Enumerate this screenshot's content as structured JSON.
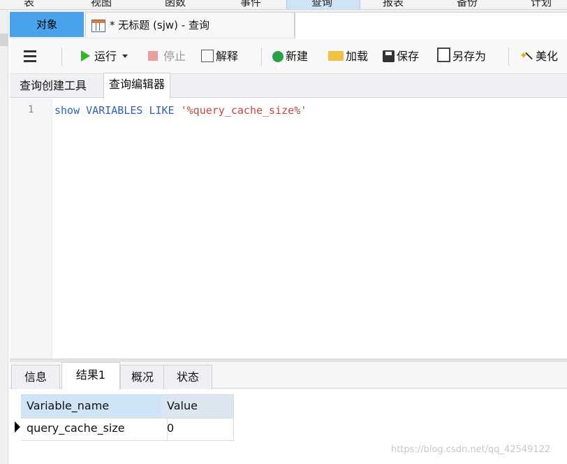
{
  "menu": {
    "items": [
      "表",
      "视图",
      "函数",
      "事件",
      "查询",
      "报表",
      "备份",
      "计划"
    ],
    "selected_index": 4
  },
  "tabs": {
    "objects_label": "对象",
    "query_tab_title": "* 无标题 (sjw) - 查询"
  },
  "toolbar": {
    "run_label": "运行",
    "stop_label": "停止",
    "explain_label": "解释",
    "new_label": "新建",
    "load_label": "加载",
    "save_label": "保存",
    "save_as_label": "另存为",
    "beautify_label": "美化"
  },
  "subtabs": {
    "builder_label": "查询创建工具",
    "editor_label": "查询编辑器"
  },
  "editor": {
    "line_number": "1",
    "code_keyword": "show VARIABLES LIKE",
    "code_string": "'%query_cache_size%'"
  },
  "results": {
    "tabs": [
      "信息",
      "结果1",
      "概况",
      "状态"
    ],
    "active_tab_index": 1,
    "columns": [
      "Variable_name",
      "Value"
    ],
    "rows": [
      [
        "query_cache_size",
        "0"
      ]
    ]
  },
  "watermark": "https://blog.csdn.net/qq_42549122",
  "colors": {
    "accent": "#4aa3ea",
    "keyword": "#2f5fbf",
    "string": "#c9473c"
  }
}
